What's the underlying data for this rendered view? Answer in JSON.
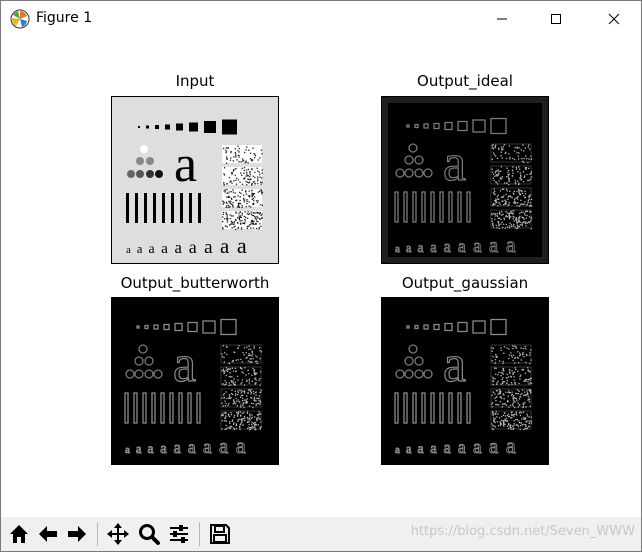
{
  "window": {
    "title": "Figure 1",
    "icons": {
      "app": "matplotlib-logo-icon",
      "minimize": "minimize-icon",
      "maximize": "maximize-icon",
      "close": "close-icon"
    }
  },
  "figure": {
    "subplots": [
      {
        "title": "Input",
        "style": "light"
      },
      {
        "title": "Output_ideal",
        "style": "dark-ring"
      },
      {
        "title": "Output_butterworth",
        "style": "dark-edge"
      },
      {
        "title": "Output_gaussian",
        "style": "dark-edge"
      }
    ],
    "colors": {
      "input_bg": "#dedede",
      "output_bg": "#000000"
    }
  },
  "toolbar": {
    "buttons": [
      {
        "name": "home-icon"
      },
      {
        "name": "back-arrow-icon"
      },
      {
        "name": "forward-arrow-icon"
      },
      {
        "name": "pan-move-icon"
      },
      {
        "name": "zoom-magnifier-icon"
      },
      {
        "name": "configure-subplots-icon"
      },
      {
        "name": "save-disk-icon"
      }
    ],
    "watermark": "https://blog.csdn.net/Seven_WWW"
  }
}
